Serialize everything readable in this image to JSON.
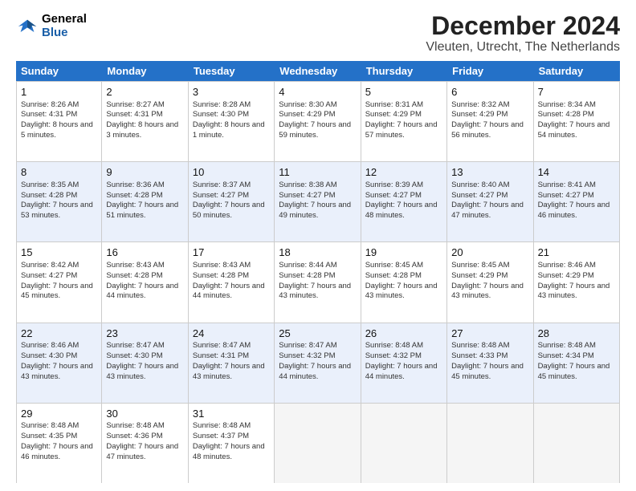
{
  "header": {
    "logo_general": "General",
    "logo_blue": "Blue",
    "month_title": "December 2024",
    "location": "Vleuten, Utrecht, The Netherlands"
  },
  "days_of_week": [
    "Sunday",
    "Monday",
    "Tuesday",
    "Wednesday",
    "Thursday",
    "Friday",
    "Saturday"
  ],
  "weeks": [
    [
      {
        "day": "1",
        "sunrise": "Sunrise: 8:26 AM",
        "sunset": "Sunset: 4:31 PM",
        "daylight": "Daylight: 8 hours and 5 minutes."
      },
      {
        "day": "2",
        "sunrise": "Sunrise: 8:27 AM",
        "sunset": "Sunset: 4:31 PM",
        "daylight": "Daylight: 8 hours and 3 minutes."
      },
      {
        "day": "3",
        "sunrise": "Sunrise: 8:28 AM",
        "sunset": "Sunset: 4:30 PM",
        "daylight": "Daylight: 8 hours and 1 minute."
      },
      {
        "day": "4",
        "sunrise": "Sunrise: 8:30 AM",
        "sunset": "Sunset: 4:29 PM",
        "daylight": "Daylight: 7 hours and 59 minutes."
      },
      {
        "day": "5",
        "sunrise": "Sunrise: 8:31 AM",
        "sunset": "Sunset: 4:29 PM",
        "daylight": "Daylight: 7 hours and 57 minutes."
      },
      {
        "day": "6",
        "sunrise": "Sunrise: 8:32 AM",
        "sunset": "Sunset: 4:29 PM",
        "daylight": "Daylight: 7 hours and 56 minutes."
      },
      {
        "day": "7",
        "sunrise": "Sunrise: 8:34 AM",
        "sunset": "Sunset: 4:28 PM",
        "daylight": "Daylight: 7 hours and 54 minutes."
      }
    ],
    [
      {
        "day": "8",
        "sunrise": "Sunrise: 8:35 AM",
        "sunset": "Sunset: 4:28 PM",
        "daylight": "Daylight: 7 hours and 53 minutes."
      },
      {
        "day": "9",
        "sunrise": "Sunrise: 8:36 AM",
        "sunset": "Sunset: 4:28 PM",
        "daylight": "Daylight: 7 hours and 51 minutes."
      },
      {
        "day": "10",
        "sunrise": "Sunrise: 8:37 AM",
        "sunset": "Sunset: 4:27 PM",
        "daylight": "Daylight: 7 hours and 50 minutes."
      },
      {
        "day": "11",
        "sunrise": "Sunrise: 8:38 AM",
        "sunset": "Sunset: 4:27 PM",
        "daylight": "Daylight: 7 hours and 49 minutes."
      },
      {
        "day": "12",
        "sunrise": "Sunrise: 8:39 AM",
        "sunset": "Sunset: 4:27 PM",
        "daylight": "Daylight: 7 hours and 48 minutes."
      },
      {
        "day": "13",
        "sunrise": "Sunrise: 8:40 AM",
        "sunset": "Sunset: 4:27 PM",
        "daylight": "Daylight: 7 hours and 47 minutes."
      },
      {
        "day": "14",
        "sunrise": "Sunrise: 8:41 AM",
        "sunset": "Sunset: 4:27 PM",
        "daylight": "Daylight: 7 hours and 46 minutes."
      }
    ],
    [
      {
        "day": "15",
        "sunrise": "Sunrise: 8:42 AM",
        "sunset": "Sunset: 4:27 PM",
        "daylight": "Daylight: 7 hours and 45 minutes."
      },
      {
        "day": "16",
        "sunrise": "Sunrise: 8:43 AM",
        "sunset": "Sunset: 4:28 PM",
        "daylight": "Daylight: 7 hours and 44 minutes."
      },
      {
        "day": "17",
        "sunrise": "Sunrise: 8:43 AM",
        "sunset": "Sunset: 4:28 PM",
        "daylight": "Daylight: 7 hours and 44 minutes."
      },
      {
        "day": "18",
        "sunrise": "Sunrise: 8:44 AM",
        "sunset": "Sunset: 4:28 PM",
        "daylight": "Daylight: 7 hours and 43 minutes."
      },
      {
        "day": "19",
        "sunrise": "Sunrise: 8:45 AM",
        "sunset": "Sunset: 4:28 PM",
        "daylight": "Daylight: 7 hours and 43 minutes."
      },
      {
        "day": "20",
        "sunrise": "Sunrise: 8:45 AM",
        "sunset": "Sunset: 4:29 PM",
        "daylight": "Daylight: 7 hours and 43 minutes."
      },
      {
        "day": "21",
        "sunrise": "Sunrise: 8:46 AM",
        "sunset": "Sunset: 4:29 PM",
        "daylight": "Daylight: 7 hours and 43 minutes."
      }
    ],
    [
      {
        "day": "22",
        "sunrise": "Sunrise: 8:46 AM",
        "sunset": "Sunset: 4:30 PM",
        "daylight": "Daylight: 7 hours and 43 minutes."
      },
      {
        "day": "23",
        "sunrise": "Sunrise: 8:47 AM",
        "sunset": "Sunset: 4:30 PM",
        "daylight": "Daylight: 7 hours and 43 minutes."
      },
      {
        "day": "24",
        "sunrise": "Sunrise: 8:47 AM",
        "sunset": "Sunset: 4:31 PM",
        "daylight": "Daylight: 7 hours and 43 minutes."
      },
      {
        "day": "25",
        "sunrise": "Sunrise: 8:47 AM",
        "sunset": "Sunset: 4:32 PM",
        "daylight": "Daylight: 7 hours and 44 minutes."
      },
      {
        "day": "26",
        "sunrise": "Sunrise: 8:48 AM",
        "sunset": "Sunset: 4:32 PM",
        "daylight": "Daylight: 7 hours and 44 minutes."
      },
      {
        "day": "27",
        "sunrise": "Sunrise: 8:48 AM",
        "sunset": "Sunset: 4:33 PM",
        "daylight": "Daylight: 7 hours and 45 minutes."
      },
      {
        "day": "28",
        "sunrise": "Sunrise: 8:48 AM",
        "sunset": "Sunset: 4:34 PM",
        "daylight": "Daylight: 7 hours and 45 minutes."
      }
    ],
    [
      {
        "day": "29",
        "sunrise": "Sunrise: 8:48 AM",
        "sunset": "Sunset: 4:35 PM",
        "daylight": "Daylight: 7 hours and 46 minutes."
      },
      {
        "day": "30",
        "sunrise": "Sunrise: 8:48 AM",
        "sunset": "Sunset: 4:36 PM",
        "daylight": "Daylight: 7 hours and 47 minutes."
      },
      {
        "day": "31",
        "sunrise": "Sunrise: 8:48 AM",
        "sunset": "Sunset: 4:37 PM",
        "daylight": "Daylight: 7 hours and 48 minutes."
      },
      null,
      null,
      null,
      null
    ]
  ]
}
